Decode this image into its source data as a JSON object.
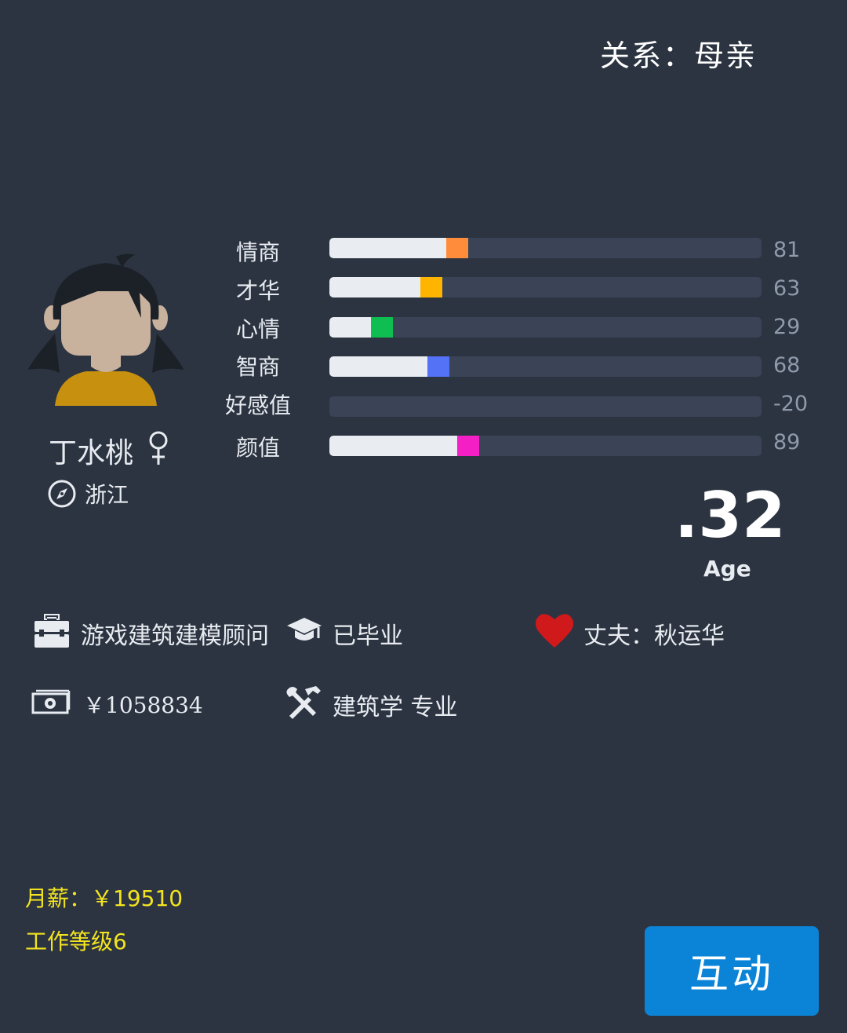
{
  "relation": "关系：母亲",
  "character": {
    "name": "丁水桃",
    "gender_symbol": "♀",
    "location": "浙江"
  },
  "stats": [
    {
      "label": "情商",
      "value": 81,
      "display": "81",
      "color": "#ff8c3b"
    },
    {
      "label": "才华",
      "value": 63,
      "display": "63",
      "color": "#ffb400"
    },
    {
      "label": "心情",
      "value": 29,
      "display": "29",
      "color": "#0fbe50"
    },
    {
      "label": "智商",
      "value": 68,
      "display": "68",
      "color": "#5472f5"
    },
    {
      "label": "好感值",
      "value": -20,
      "display": "-20",
      "color": null
    },
    {
      "label": "颜值",
      "value": 89,
      "display": "89",
      "color": "#f41fc5"
    }
  ],
  "age": {
    "value": ".32",
    "label": "Age"
  },
  "info": {
    "job": "游戏建筑建模顾问",
    "education": "已毕业",
    "spouse": "丈夫：秋运华",
    "money": "￥1058834",
    "major": "建筑学 专业"
  },
  "salary": "月薪：￥19510",
  "job_level": "工作等级6",
  "interact_button": "互动",
  "icons": {
    "job": "briefcase-icon",
    "education": "graduation-cap-icon",
    "spouse": "heart-icon",
    "money": "banknote-icon",
    "major": "tools-icon",
    "location": "compass-icon"
  },
  "colors": {
    "background": "#2c3441",
    "bar_track": "#3a4456",
    "bar_fill": "#e9edf2",
    "heart": "#d0191b",
    "yellow_text": "#f3e41f",
    "button": "#0b84d8"
  }
}
